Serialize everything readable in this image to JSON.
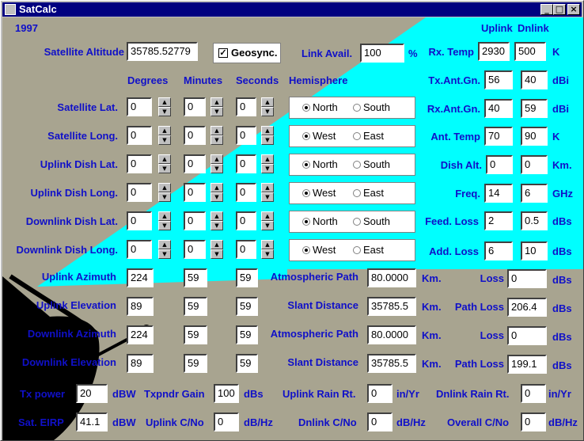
{
  "window": {
    "title": "SatCalc"
  },
  "year": "1997",
  "geo": {
    "altitude_label": "Satellite Altitude",
    "altitude_value": "35785.52779",
    "geosync_label": "Geosync.",
    "geosync_checked": true
  },
  "link": {
    "label": "Link Avail.",
    "value": "100",
    "unit": "%"
  },
  "col_headers": {
    "degrees": "Degrees",
    "minutes": "Minutes",
    "seconds": "Seconds",
    "hemisphere": "Hemisphere",
    "uplink": "Uplink",
    "dnlink": "Dnlink"
  },
  "coords": [
    {
      "label": "Satellite Lat.",
      "deg": "0",
      "min": "0",
      "sec": "0",
      "opt1": "North",
      "opt2": "South",
      "selected": 1
    },
    {
      "label": "Satellite Long.",
      "deg": "0",
      "min": "0",
      "sec": "0",
      "opt1": "West",
      "opt2": "East",
      "selected": 1
    },
    {
      "label": "Uplink Dish Lat.",
      "deg": "0",
      "min": "0",
      "sec": "0",
      "opt1": "North",
      "opt2": "South",
      "selected": 1
    },
    {
      "label": "Uplink Dish Long.",
      "deg": "0",
      "min": "0",
      "sec": "0",
      "opt1": "West",
      "opt2": "East",
      "selected": 1
    },
    {
      "label": "Downlink Dish Lat.",
      "deg": "0",
      "min": "0",
      "sec": "0",
      "opt1": "North",
      "opt2": "South",
      "selected": 1
    },
    {
      "label": "Downlink Dish Long.",
      "deg": "0",
      "min": "0",
      "sec": "0",
      "opt1": "West",
      "opt2": "East",
      "selected": 1
    }
  ],
  "params": [
    {
      "label": "Rx. Temp",
      "up": "2930",
      "dn": "500",
      "unit": "K"
    },
    {
      "label": "Tx.Ant.Gn.",
      "up": "56",
      "dn": "40",
      "unit": "dBi"
    },
    {
      "label": "Rx.Ant.Gn.",
      "up": "40",
      "dn": "59",
      "unit": "dBi"
    },
    {
      "label": "Ant. Temp",
      "up": "70",
      "dn": "90",
      "unit": "K"
    },
    {
      "label": "Dish Alt.",
      "up": "0",
      "dn": "0",
      "unit": "Km."
    },
    {
      "label": "Freq.",
      "up": "14",
      "dn": "6",
      "unit": "GHz"
    },
    {
      "label": "Feed. Loss",
      "up": "2",
      "dn": "0.5",
      "unit": "dBs"
    },
    {
      "label": "Add. Loss",
      "up": "6",
      "dn": "10",
      "unit": "dBs"
    }
  ],
  "angles": [
    {
      "label": "Uplink Azimuth",
      "deg": "224",
      "min": "59",
      "sec": "59"
    },
    {
      "label": "Uplink Elevation",
      "deg": "89",
      "min": "59",
      "sec": "59"
    },
    {
      "label": "Downlink Azimuth",
      "deg": "224",
      "min": "59",
      "sec": "59"
    },
    {
      "label": "Downlink Elevation",
      "deg": "89",
      "min": "59",
      "sec": "59"
    }
  ],
  "paths": [
    {
      "label": "Atmospheric Path",
      "value": "80.0000",
      "unit": "Km.",
      "loss_label": "Loss",
      "loss_value": "0",
      "loss_unit": "dBs"
    },
    {
      "label": "Slant Distance",
      "value": "35785.5",
      "unit": "Km.",
      "loss_label": "Path Loss",
      "loss_value": "206.4",
      "loss_unit": "dBs"
    },
    {
      "label": "Atmospheric Path",
      "value": "80.0000",
      "unit": "Km.",
      "loss_label": "Loss",
      "loss_value": "0",
      "loss_unit": "dBs"
    },
    {
      "label": "Slant Distance",
      "value": "35785.5",
      "unit": "Km.",
      "loss_label": "Path Loss",
      "loss_value": "199.1",
      "loss_unit": "dBs"
    }
  ],
  "bottom": {
    "tx_power": {
      "label": "Tx power",
      "value": "20",
      "unit": "dBW"
    },
    "txpndr": {
      "label": "Txpndr Gain",
      "value": "100",
      "unit": "dBs"
    },
    "uplink_rain": {
      "label": "Uplink Rain Rt.",
      "value": "0",
      "unit": "in/Yr"
    },
    "dnlink_rain": {
      "label": "Dnlink Rain Rt.",
      "value": "0",
      "unit": "in/Yr"
    },
    "sat_eirp": {
      "label": "Sat. EIRP",
      "value": "41.1",
      "unit": "dBW"
    },
    "uplink_cno": {
      "label": "Uplink C/No",
      "value": "0",
      "unit": "dB/Hz"
    },
    "dnlink_cno": {
      "label": "Dnlink C/No",
      "value": "0",
      "unit": "dB/Hz"
    },
    "overall_cno": {
      "label": "Overall C/No",
      "value": "0",
      "unit": "dB/Hz"
    }
  },
  "colors": {
    "label": "#1010c8",
    "cyan": "#00ffff",
    "background": "#a8a490",
    "titlebar": "#000080"
  },
  "icons": {
    "minimize": "minimize-icon",
    "maximize": "maximize-icon",
    "close": "close-icon",
    "dish": "satellite-dish-icon",
    "check": "checkmark-icon"
  }
}
